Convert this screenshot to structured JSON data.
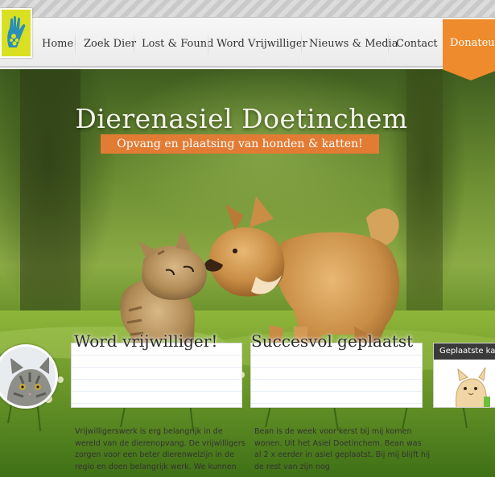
{
  "site": {
    "logo_icon": "hand-paw-logo-icon",
    "brand_colors": {
      "logo_bg": "#d9e021",
      "accent": "#ee8b2c",
      "subtitle_bg": "#e27b34"
    }
  },
  "nav": {
    "items": [
      {
        "label": "Home"
      },
      {
        "label": "Zoek Dier"
      },
      {
        "label": "Lost & Found"
      },
      {
        "label": "Word Vrijwilliger"
      },
      {
        "label": "Nieuws & Media"
      },
      {
        "label": "Contact"
      }
    ],
    "donate_label": "Donateu"
  },
  "hero": {
    "title": "Dierenasiel Doetinchem",
    "subtitle": "Opvang en plaatsing van honden & katten!",
    "image_subject": "kitten-and-puppy-photo"
  },
  "cards": {
    "volunteer": {
      "title": "Word vrijwilliger!",
      "lines": [
        "Vrijwilligerswerk is erg belangrijk in de",
        "wereld van de dierenopvang. De vrijwilligers",
        "zorgen voor een beter dierenwelzijn in de",
        "regio en doen belangrijk werk. We kunnen"
      ]
    },
    "placed": {
      "title": "Succesvol geplaatst",
      "lines": [
        "Bean is de week voor kerst bij mij komen",
        "wonen. Uit het Asiel Doetinchem. Bean was",
        "al 2 x eerder in asiel geplaatst. Bij mij blijft hij",
        "de rest van zijn nog"
      ]
    },
    "geplaatste": {
      "title": "Geplaatste ka"
    }
  }
}
